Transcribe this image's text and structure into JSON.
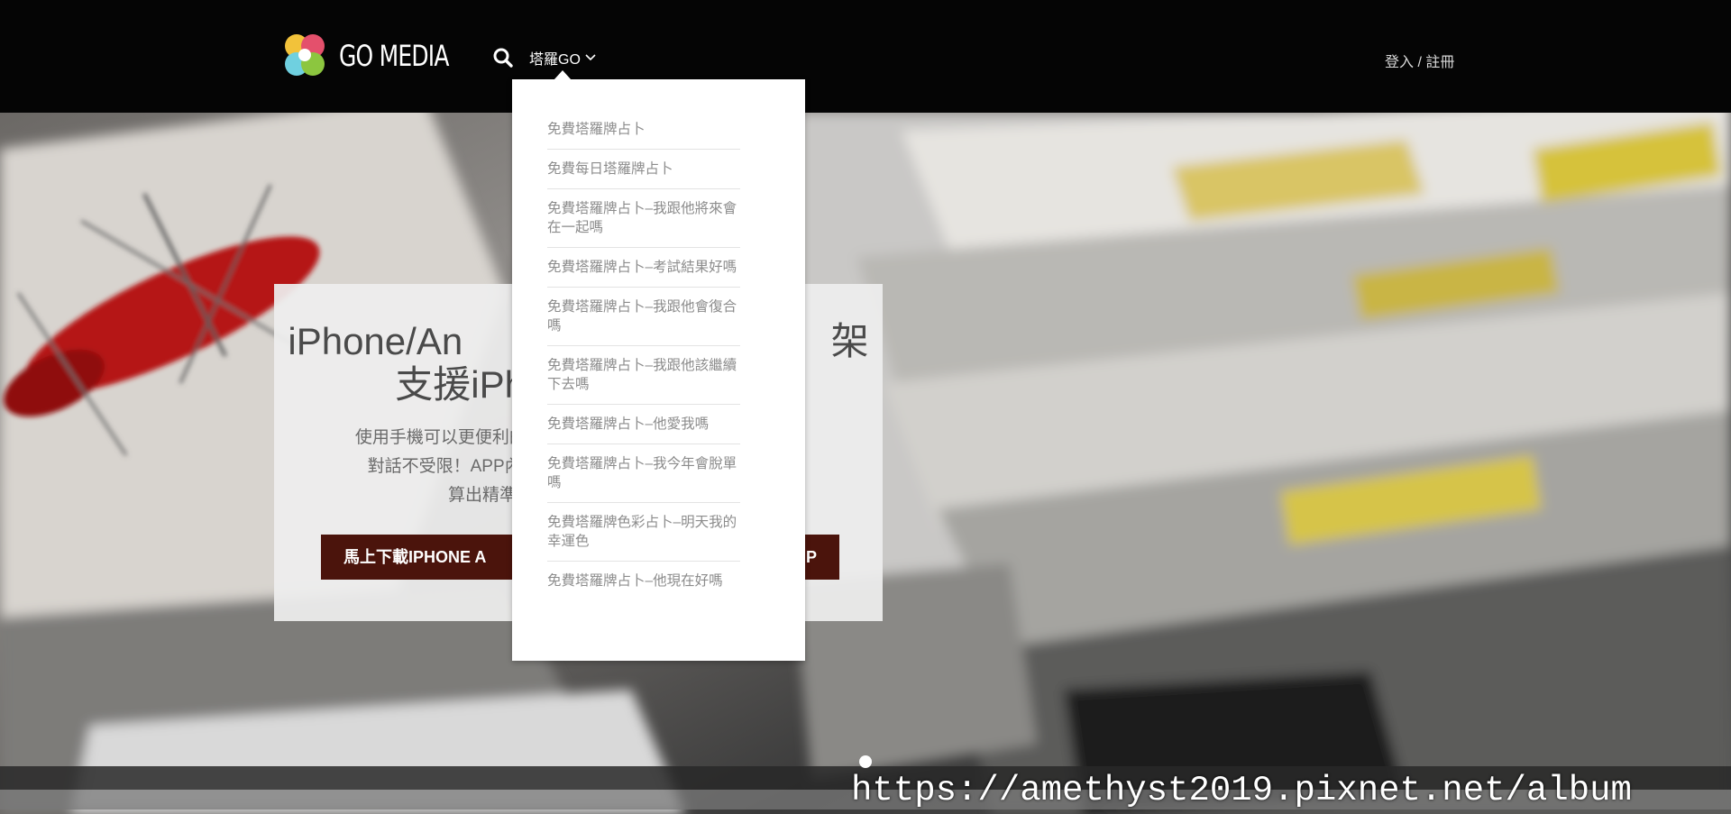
{
  "header": {
    "logo_text": "GO MEDIA",
    "search_icon": "search-icon",
    "nav_label": "塔羅GO",
    "nav_chevron_icon": "chevron-down-icon",
    "login_label": "登入 / 註冊"
  },
  "dropdown": {
    "items": [
      "免費塔羅牌占卜",
      "免費每日塔羅牌占卜",
      "免費塔羅牌占卜–我跟他將來會在一起嗎",
      "免費塔羅牌占卜–考試結果好嗎",
      "免費塔羅牌占卜–我跟他會復合嗎",
      "免費塔羅牌占卜–我跟他該繼續下去嗎",
      "免費塔羅牌占卜–他愛我嗎",
      "免費塔羅牌占卜–我今年會脫單嗎",
      "免費塔羅牌色彩占卜–明天我的幸運色",
      "免費塔羅牌占卜–他現在好嗎"
    ]
  },
  "promo": {
    "title_line1": "iPhone/An                                   架",
    "title_line2": "支援iPhon",
    "desc_line1": "使用手機可以更便利的使用                                        所盡情",
    "desc_line2": "對話不受限！APP內也有                                          您推",
    "desc_line3": "算出精準的",
    "button_left": "馬上下載IPHONE A",
    "button_right": "P"
  },
  "watermark": {
    "text": "https://amethyst2019.pixnet.net/album"
  },
  "colors": {
    "header_bg": "#050505",
    "button_bg": "#4b140c",
    "dropdown_text": "#8c8c8c"
  }
}
